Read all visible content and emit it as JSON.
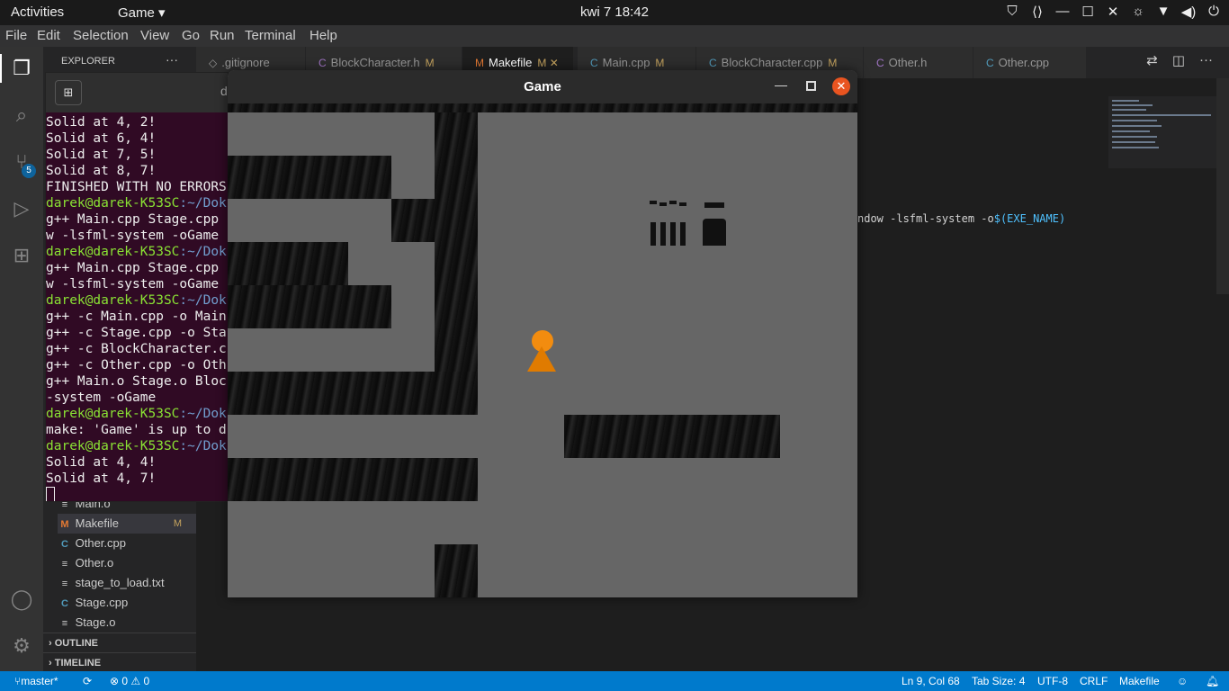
{
  "topbar": {
    "activities": "Activities",
    "app_menu": "Game ▾",
    "clock": "kwi 7  18:42",
    "tray_icons": [
      "shield-icon",
      "vscode-icon",
      "close-icon",
      "maximize-icon",
      "close-icon",
      "brightness-icon",
      "wifi-icon",
      "volume-icon",
      "power-icon"
    ]
  },
  "menubar": {
    "items": [
      "File",
      "Edit",
      "Selection",
      "View",
      "Go",
      "Run",
      "Terminal",
      "Help"
    ]
  },
  "activity_bar": {
    "source_control_badge": "5"
  },
  "sidebar": {
    "title": "EXPLORER",
    "more": "···",
    "files": [
      {
        "name": "Main.o",
        "icon": "≡"
      },
      {
        "name": "Makefile",
        "icon": "M",
        "modified": "M"
      },
      {
        "name": "Other.cpp",
        "icon": "C"
      },
      {
        "name": "Other.o",
        "icon": "≡"
      },
      {
        "name": "stage_to_load.txt",
        "icon": "≡"
      },
      {
        "name": "Stage.cpp",
        "icon": "C"
      },
      {
        "name": "Stage.o",
        "icon": "≡"
      }
    ],
    "outline": "OUTLINE",
    "timeline": "TIMELINE"
  },
  "tabs": [
    {
      "label": ".gitignore",
      "icon": "◇",
      "modified": ""
    },
    {
      "label": "BlockCharacter.h",
      "icon": "C",
      "modified": "M"
    },
    {
      "label": "Makefile",
      "icon": "M",
      "modified": "M ✕"
    },
    {
      "label": "Main.cpp",
      "icon": "C",
      "modified": "M"
    },
    {
      "label": "BlockCharacter.cpp",
      "icon": "C",
      "modified": "M"
    },
    {
      "label": "Other.h",
      "icon": "C",
      "modified": ""
    },
    {
      "label": "Other.cpp",
      "icon": "C",
      "modified": ""
    }
  ],
  "editor": {
    "visible_code_prefix": "ndow -lsfml-system -o",
    "visible_code_var": "$(EXE_NAME)"
  },
  "terminal": {
    "header_title_fragment": "d",
    "lines": [
      {
        "type": "out",
        "text": "Solid at 4, 2!"
      },
      {
        "type": "out",
        "text": "Solid at 6, 4!"
      },
      {
        "type": "out",
        "text": "Solid at 7, 5!"
      },
      {
        "type": "out",
        "text": "Solid at 8, 7!"
      },
      {
        "type": "out",
        "text": "FINISHED WITH NO ERRORS"
      },
      {
        "type": "prompt",
        "user": "darek@darek-K53SC",
        "path": ":~/Dok"
      },
      {
        "type": "out",
        "text": "g++ Main.cpp Stage.cpp"
      },
      {
        "type": "out",
        "text": "w -lsfml-system -oGame"
      },
      {
        "type": "prompt",
        "user": "darek@darek-K53SC",
        "path": ":~/Dok"
      },
      {
        "type": "out",
        "text": "g++ Main.cpp Stage.cpp"
      },
      {
        "type": "out",
        "text": "w -lsfml-system -oGame"
      },
      {
        "type": "prompt",
        "user": "darek@darek-K53SC",
        "path": ":~/Dok"
      },
      {
        "type": "out",
        "text": "g++ -c Main.cpp -o Main"
      },
      {
        "type": "out",
        "text": "g++ -c Stage.cpp -o Sta"
      },
      {
        "type": "out",
        "text": "g++ -c BlockCharacter.c"
      },
      {
        "type": "out",
        "text": "g++ -c Other.cpp -o Oth"
      },
      {
        "type": "out",
        "text": "g++ Main.o Stage.o Bloc"
      },
      {
        "type": "out",
        "text": "-system -oGame"
      },
      {
        "type": "prompt",
        "user": "darek@darek-K53SC",
        "path": ":~/Dok"
      },
      {
        "type": "out",
        "text": "make: 'Game' is up to d"
      },
      {
        "type": "prompt",
        "user": "darek@darek-K53SC",
        "path": ":~/Dok"
      },
      {
        "type": "out",
        "text": "Solid at 4, 4!"
      },
      {
        "type": "out",
        "text": "Solid at 4, 7!"
      }
    ]
  },
  "game_window": {
    "title": "Game",
    "minimize": "—",
    "close": "✕"
  },
  "statusbar": {
    "branch": "master*",
    "sync": "⟳",
    "problems": "⊗ 0 ⚠ 0",
    "position": "Ln 9, Col 68",
    "tab_size": "Tab Size: 4",
    "encoding": "UTF-8",
    "eol": "CRLF",
    "language": "Makefile"
  },
  "colors": {
    "accent": "#007acc",
    "player": "#f28c0f",
    "terminal_bg": "#300a24",
    "close_button": "#e95420"
  }
}
